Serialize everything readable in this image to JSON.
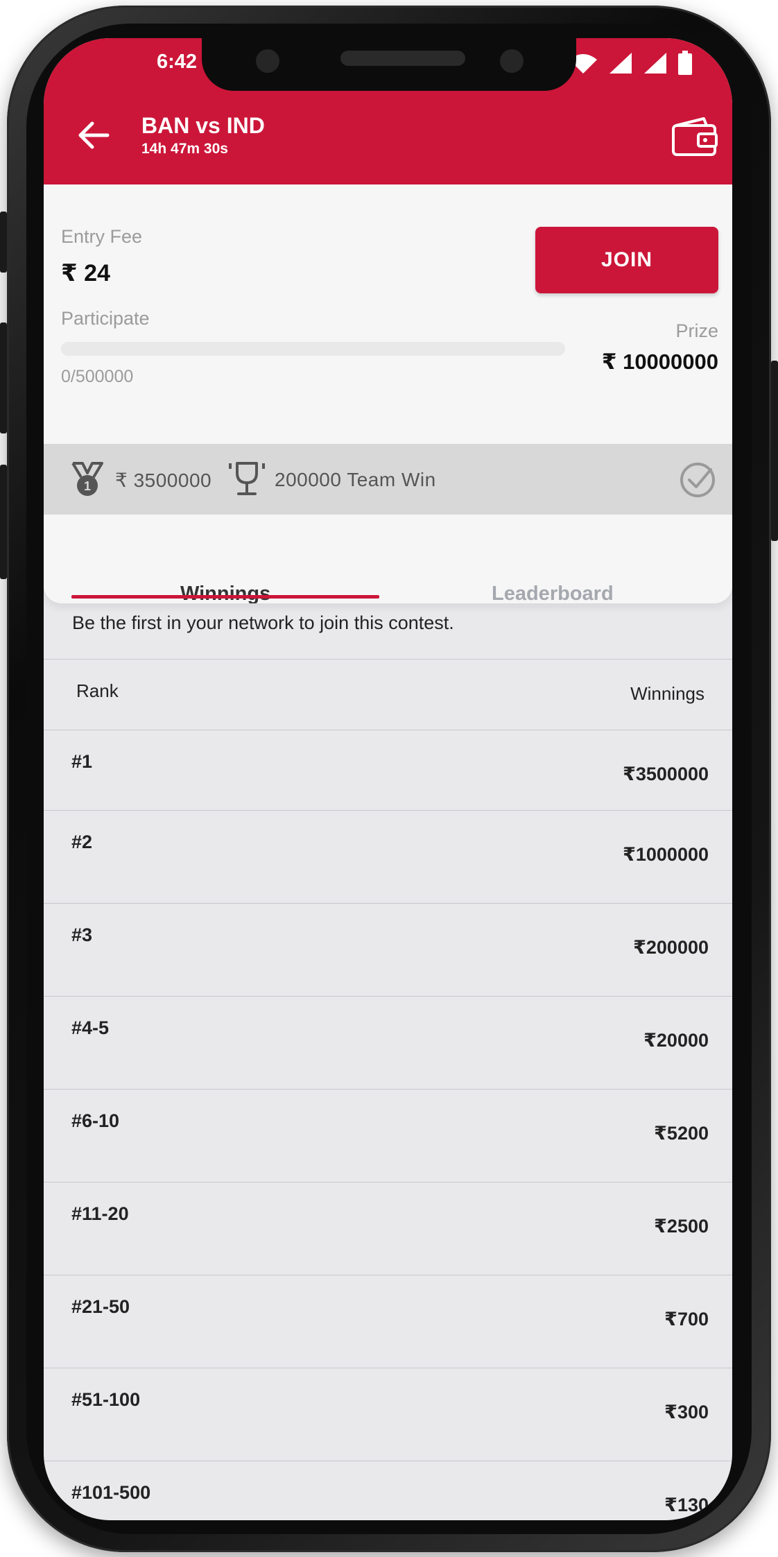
{
  "status": {
    "time": "6:42"
  },
  "header": {
    "title": "BAN vs IND",
    "countdown": "14h 47m 30s",
    "back_icon": "arrow-left-icon",
    "wallet_icon": "wallet-icon"
  },
  "contest": {
    "entry_fee_label": "Entry Fee",
    "entry_fee_value": "₹ 24",
    "join_label": "JOIN",
    "participate_label": "Participate",
    "participants": "0/500000",
    "participation_fraction": 0,
    "prize_label": "Prize",
    "prize_value": "₹ 10000000",
    "first_prize": "₹ 3500000",
    "team_win": "200000 Team Win"
  },
  "tabs": [
    {
      "label": "Winnings",
      "active": true
    },
    {
      "label": "Leaderboard",
      "active": false
    }
  ],
  "network_note": "Be the first in your network to join this contest.",
  "table": {
    "rank_header": "Rank",
    "winnings_header": "Winnings",
    "rows": [
      {
        "rank": "#1",
        "amount": "₹3500000"
      },
      {
        "rank": "#2",
        "amount": "₹1000000"
      },
      {
        "rank": "#3",
        "amount": "₹200000"
      },
      {
        "rank": "#4-5",
        "amount": "₹20000"
      },
      {
        "rank": "#6-10",
        "amount": "₹5200"
      },
      {
        "rank": "#11-20",
        "amount": "₹2500"
      },
      {
        "rank": "#21-50",
        "amount": "₹700"
      },
      {
        "rank": "#51-100",
        "amount": "₹300"
      },
      {
        "rank": "#101-500",
        "amount": "₹130"
      }
    ]
  },
  "colors": {
    "accent": "#cc1639",
    "strip": "#d8d8d8",
    "list_bg": "#e9e9ec"
  }
}
